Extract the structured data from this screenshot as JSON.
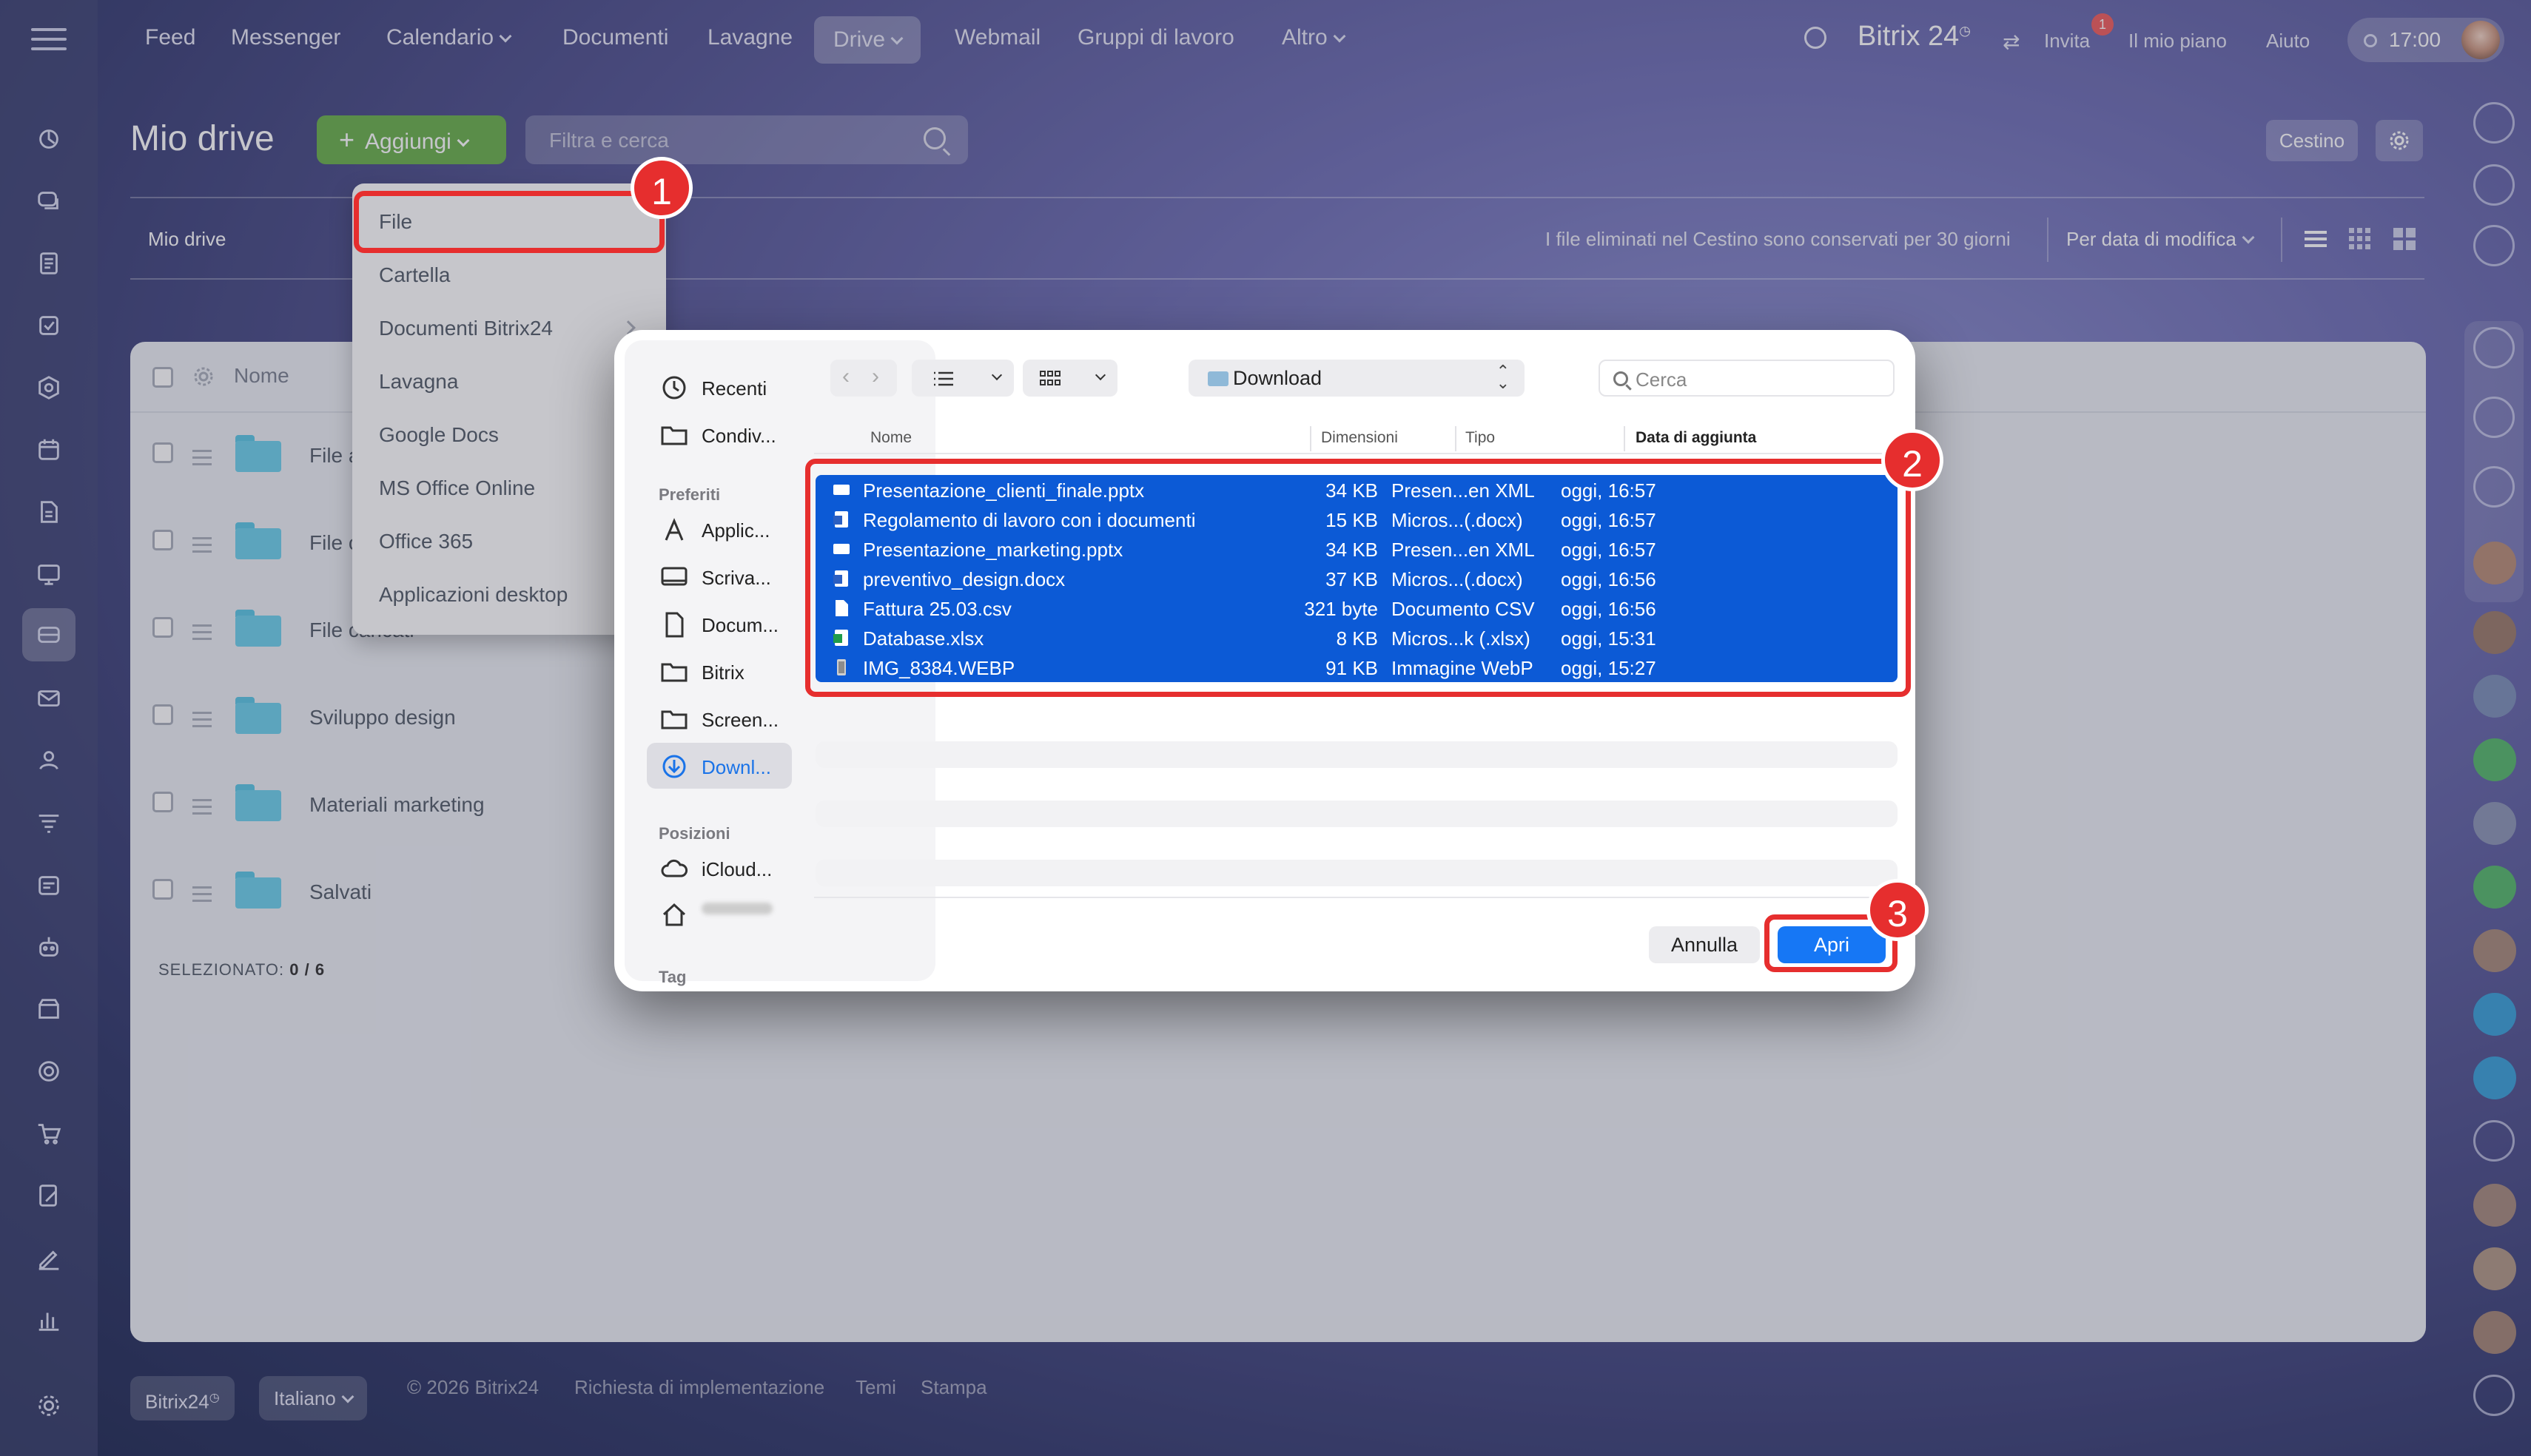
{
  "topnav": {
    "items": [
      {
        "label": "Feed"
      },
      {
        "label": "Messenger"
      },
      {
        "label": "Calendario"
      },
      {
        "label": "Documenti"
      },
      {
        "label": "Lavagne"
      },
      {
        "label": "Drive"
      },
      {
        "label": "Webmail"
      },
      {
        "label": "Gruppi di lavoro"
      },
      {
        "label": "Altro"
      }
    ],
    "brand": "Bitrix",
    "brand_num": "24",
    "invita": "Invita",
    "invita_badge": "1",
    "piano": "Il mio piano",
    "aiuto": "Aiuto",
    "time": "17:00"
  },
  "header": {
    "title": "Mio drive",
    "add_label": "Aggiungi",
    "filter_placeholder": "Filtra e cerca",
    "cestino": "Cestino"
  },
  "toolbar": {
    "breadcrumb": "Mio drive",
    "info": "I file eliminati nel Cestino sono conservati per 30 giorni",
    "sort": "Per data di modifica"
  },
  "list": {
    "col_name": "Nome",
    "rows": [
      {
        "name": "File a"
      },
      {
        "name": "File c"
      },
      {
        "name": "File caricati"
      },
      {
        "name": "Sviluppo design"
      },
      {
        "name": "Materiali marketing"
      },
      {
        "name": "Salvati"
      }
    ],
    "selected_label": "SELEZIONATO:",
    "selected_count": "0 / 6"
  },
  "dropdown": {
    "items": [
      {
        "label": "File"
      },
      {
        "label": "Cartella"
      },
      {
        "label": "Documenti Bitrix24"
      },
      {
        "label": "Lavagna"
      },
      {
        "label": "Google Docs"
      },
      {
        "label": "MS Office Online"
      },
      {
        "label": "Office 365"
      },
      {
        "label": "Applicazioni desktop"
      }
    ]
  },
  "footer": {
    "brand": "Bitrix24",
    "lang": "Italiano",
    "copyright": "© 2026 Bitrix24",
    "impl": "Richiesta di implementazione",
    "temi": "Temi",
    "stampa": "Stampa"
  },
  "dialog": {
    "sidebar": {
      "recenti": "Recenti",
      "condiv": "Condiv...",
      "section_pref": "Preferiti",
      "applic": "Applic...",
      "scriva": "Scriva...",
      "docum": "Docum...",
      "bitrix": "Bitrix",
      "screen": "Screen...",
      "downl": "Downl...",
      "section_pos": "Posizioni",
      "icloud": "iCloud...",
      "section_tag": "Tag"
    },
    "location": "Download",
    "search_placeholder": "Cerca",
    "columns": {
      "name": "Nome",
      "size": "Dimensioni",
      "type": "Tipo",
      "date": "Data di aggiunta"
    },
    "files": [
      {
        "name": "Presentazione_clienti_finale.pptx",
        "size": "34 KB",
        "type": "Presen...en XML",
        "date": "oggi, 16:57",
        "icon": "pptx-icon"
      },
      {
        "name": "Regolamento di lavoro con i documenti",
        "size": "15 KB",
        "type": "Micros...(.docx)",
        "date": "oggi, 16:57",
        "icon": "docx-icon"
      },
      {
        "name": "Presentazione_marketing.pptx",
        "size": "34 KB",
        "type": "Presen...en XML",
        "date": "oggi, 16:57",
        "icon": "pptx-icon"
      },
      {
        "name": "preventivo_design.docx",
        "size": "37 KB",
        "type": "Micros...(.docx)",
        "date": "oggi, 16:56",
        "icon": "docx-icon"
      },
      {
        "name": "Fattura 25.03.csv",
        "size": "321 byte",
        "type": "Documento CSV",
        "date": "oggi, 16:56",
        "icon": "csv-icon"
      },
      {
        "name": "Database.xlsx",
        "size": "8 KB",
        "type": "Micros...k (.xlsx)",
        "date": "oggi, 15:31",
        "icon": "xlsx-icon"
      },
      {
        "name": "IMG_8384.WEBP",
        "size": "91 KB",
        "type": "Immagine WebP",
        "date": "oggi, 15:27",
        "icon": "image-icon"
      }
    ],
    "cancel": "Annulla",
    "open": "Apri"
  },
  "annotations": [
    "1",
    "2",
    "3"
  ],
  "colors": {
    "accent_green": "#6ab04c",
    "highlight_red": "#e62e2e",
    "mac_selection": "#0c5ad6",
    "mac_blue_button": "#1677f5"
  }
}
